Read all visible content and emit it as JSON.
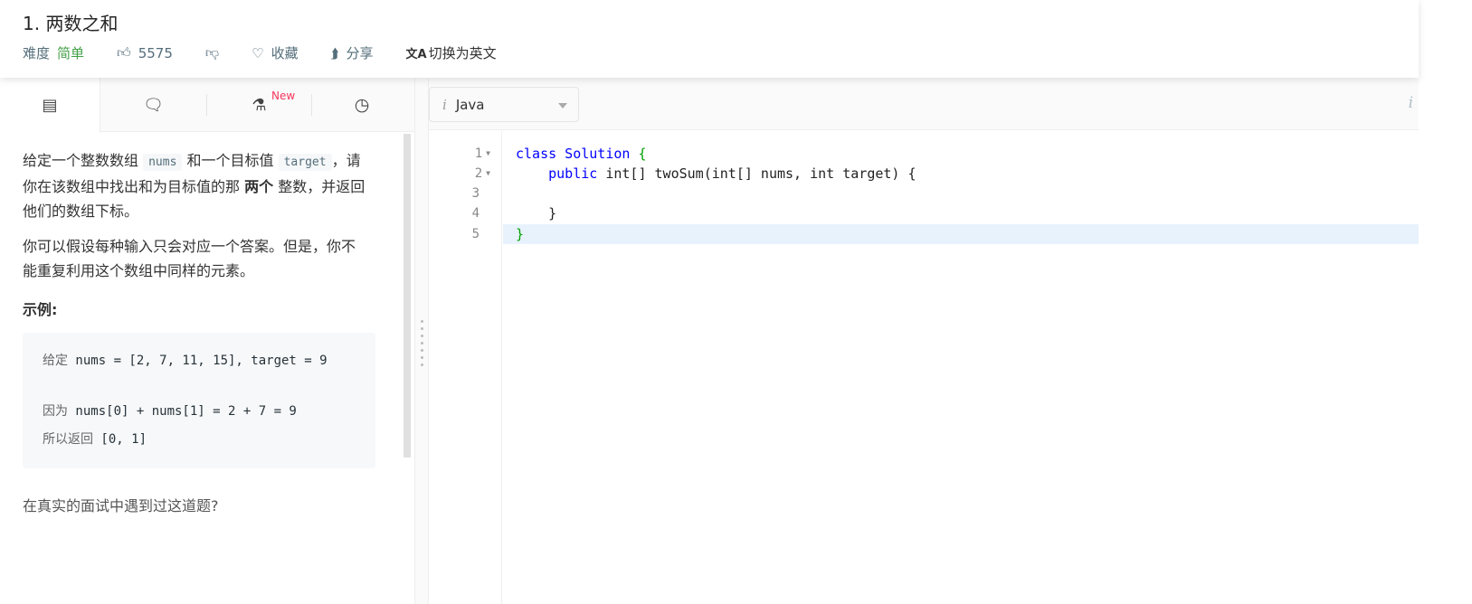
{
  "header": {
    "title": "1. 两数之和",
    "difficulty_label": "难度",
    "difficulty": "简单",
    "likes": "5575",
    "favorite": "收藏",
    "share": "分享",
    "switch_lang": "切换为英文"
  },
  "tabs": {
    "new_badge": "New",
    "items": [
      "description",
      "solutions",
      "lab",
      "submissions"
    ]
  },
  "description": {
    "p1_a": "给定一个整数数组 ",
    "p1_code1": "nums",
    "p1_b": " 和一个目标值 ",
    "p1_code2": "target",
    "p1_c": "，请你在该数组中找出和为目标值的那 ",
    "p1_bold": "两个",
    "p1_d": " 整数，并返回他们的数组下标。",
    "p2": "你可以假设每种输入只会对应一个答案。但是，你不能重复利用这个数组中同样的元素。",
    "example_heading": "示例:",
    "ex1_cn": "给定",
    "ex1_code": " nums = [2, 7, 11, 15], target = 9",
    "ex2_cn": "因为",
    "ex2_code": " nums[0] + nums[1] = 2 + 7 = 9",
    "ex3_cn": "所以返回",
    "ex3_code": " [0, 1]",
    "interview": "在真实的面试中遇到过这道题?"
  },
  "editor": {
    "language": "Java",
    "lines": [
      "1",
      "2",
      "3",
      "4",
      "5"
    ]
  },
  "colors": {
    "accent_green": "#43a047",
    "keyword": "#0000ff",
    "brace": "#00a000",
    "new_badge": "#f5365c"
  }
}
